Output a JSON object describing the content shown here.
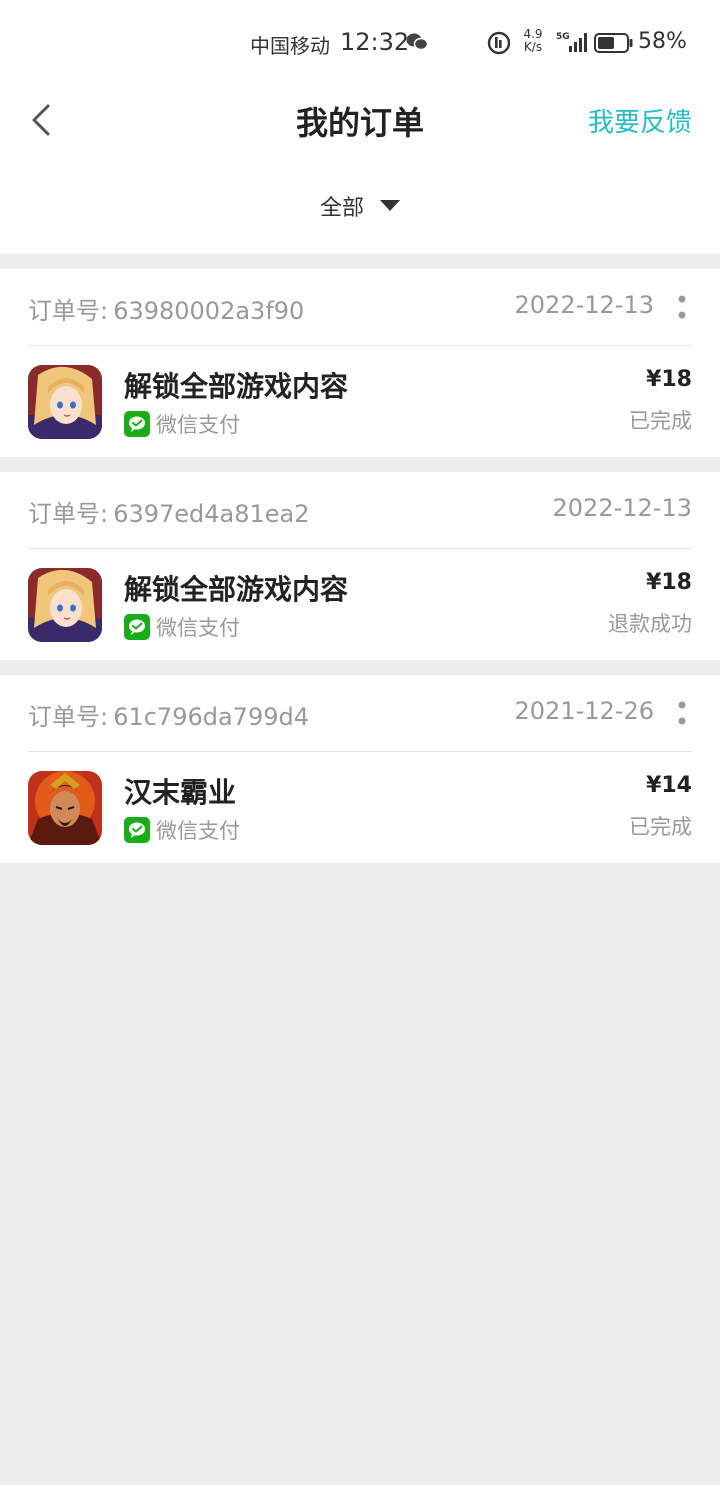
{
  "status_bar": {
    "carrier": "中国移动",
    "time": "12:32",
    "speed_value": "4.9",
    "speed_unit": "K/s",
    "network": "5G",
    "battery": "58%"
  },
  "header": {
    "title": "我的订单",
    "feedback_label": "我要反馈"
  },
  "filter": {
    "selected": "全部"
  },
  "colors": {
    "accent": "#26bdc6",
    "wechat_green": "#1aad19",
    "background": "#ededed"
  },
  "orders": [
    {
      "id_label": "订单号:",
      "id": "63980002a3f90",
      "date": "2022-12-13",
      "product": "解锁全部游戏内容",
      "payment": "微信支付",
      "price": "¥18",
      "status": "已完成",
      "icon": "anime-girl-game-icon"
    },
    {
      "id_label": "订单号:",
      "id": "6397ed4a81ea2",
      "date": "2022-12-13",
      "product": "解锁全部游戏内容",
      "payment": "微信支付",
      "price": "¥18",
      "status": "退款成功",
      "icon": "anime-girl-game-icon"
    },
    {
      "id_label": "订单号:",
      "id": "61c796da799d4",
      "date": "2021-12-26",
      "product": "汉末霸业",
      "payment": "微信支付",
      "price": "¥14",
      "status": "已完成",
      "icon": "warrior-game-icon"
    }
  ]
}
